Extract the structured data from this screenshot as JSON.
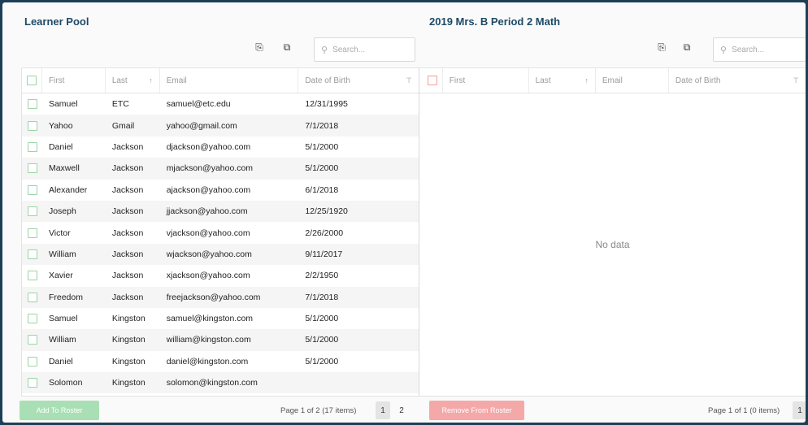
{
  "left_panel": {
    "title": "Learner Pool",
    "search_placeholder": "Search...",
    "columns": {
      "first": "First",
      "last": "Last",
      "email": "Email",
      "dob": "Date of Birth"
    },
    "rows": [
      {
        "first": "Samuel",
        "last": "ETC",
        "email": "samuel@etc.edu",
        "dob": "12/31/1995"
      },
      {
        "first": "Yahoo",
        "last": "Gmail",
        "email": "yahoo@gmail.com",
        "dob": "7/1/2018"
      },
      {
        "first": "Daniel",
        "last": "Jackson",
        "email": "djackson@yahoo.com",
        "dob": "5/1/2000"
      },
      {
        "first": "Maxwell",
        "last": "Jackson",
        "email": "mjackson@yahoo.com",
        "dob": "5/1/2000"
      },
      {
        "first": "Alexander",
        "last": "Jackson",
        "email": "ajackson@yahoo.com",
        "dob": "6/1/2018"
      },
      {
        "first": "Joseph",
        "last": "Jackson",
        "email": "jjackson@yahoo.com",
        "dob": "12/25/1920"
      },
      {
        "first": "Victor",
        "last": "Jackson",
        "email": "vjackson@yahoo.com",
        "dob": "2/26/2000"
      },
      {
        "first": "William",
        "last": "Jackson",
        "email": "wjackson@yahoo.com",
        "dob": "9/11/2017"
      },
      {
        "first": "Xavier",
        "last": "Jackson",
        "email": "xjackson@yahoo.com",
        "dob": "2/2/1950"
      },
      {
        "first": "Freedom",
        "last": "Jackson",
        "email": "freejackson@yahoo.com",
        "dob": "7/1/2018"
      },
      {
        "first": "Samuel",
        "last": "Kingston",
        "email": "samuel@kingston.com",
        "dob": "5/1/2000"
      },
      {
        "first": "William",
        "last": "Kingston",
        "email": "william@kingston.com",
        "dob": "5/1/2000"
      },
      {
        "first": "Daniel",
        "last": "Kingston",
        "email": "daniel@kingston.com",
        "dob": "5/1/2000"
      },
      {
        "first": "Solomon",
        "last": "Kingston",
        "email": "solomon@kingston.com",
        "dob": ""
      }
    ],
    "add_button": "Add To Roster",
    "pager_text": "Page 1 of 2 (17 items)",
    "pages": [
      "1",
      "2"
    ]
  },
  "right_panel": {
    "title": "2019 Mrs. B Period 2 Math",
    "search_placeholder": "Search...",
    "columns": {
      "first": "First",
      "last": "Last",
      "email": "Email",
      "dob": "Date of Birth"
    },
    "no_data": "No data",
    "remove_button": "Remove From Roster",
    "pager_text": "Page 1 of 1 (0 items)",
    "pages": [
      "1"
    ]
  },
  "icons": {
    "sort_up": "↑",
    "filter": "⊤",
    "export": "⎘",
    "copy": "⧉",
    "search": "⚲"
  },
  "colors": {
    "title": "#1e4a66",
    "add_button": "#a9dfb4",
    "remove_button": "#f5a8a8"
  }
}
